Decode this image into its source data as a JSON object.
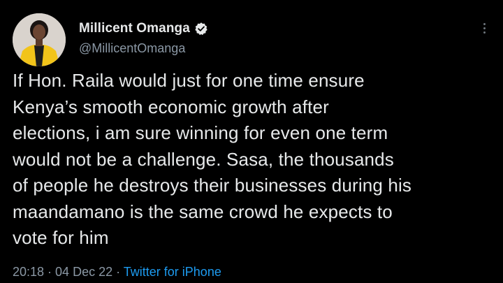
{
  "author": {
    "display_name": "Millicent Omanga",
    "handle": "@MillicentOmanga",
    "verified_icon": "verified-badge-icon",
    "avatar_icon": "profile-avatar"
  },
  "tweet": {
    "text": "If Hon. Raila would just for one time ensure\nKenya’s smooth economic growth after\nelections, i am sure winning for even one term\nwould not be a challenge. Sasa, the thousands\nof people he destroys their businesses during his\nmaandamano is the same crowd he expects to\nvote for him"
  },
  "meta": {
    "time": "20:18",
    "separator": " · ",
    "date": "04 Dec 22",
    "source": "Twitter for iPhone"
  },
  "menu": {
    "icon": "more-options-icon"
  },
  "colors": {
    "background": "#000000",
    "text": "#e7e9ea",
    "secondary_text": "#8b98a5",
    "link": "#1d9bf0"
  }
}
